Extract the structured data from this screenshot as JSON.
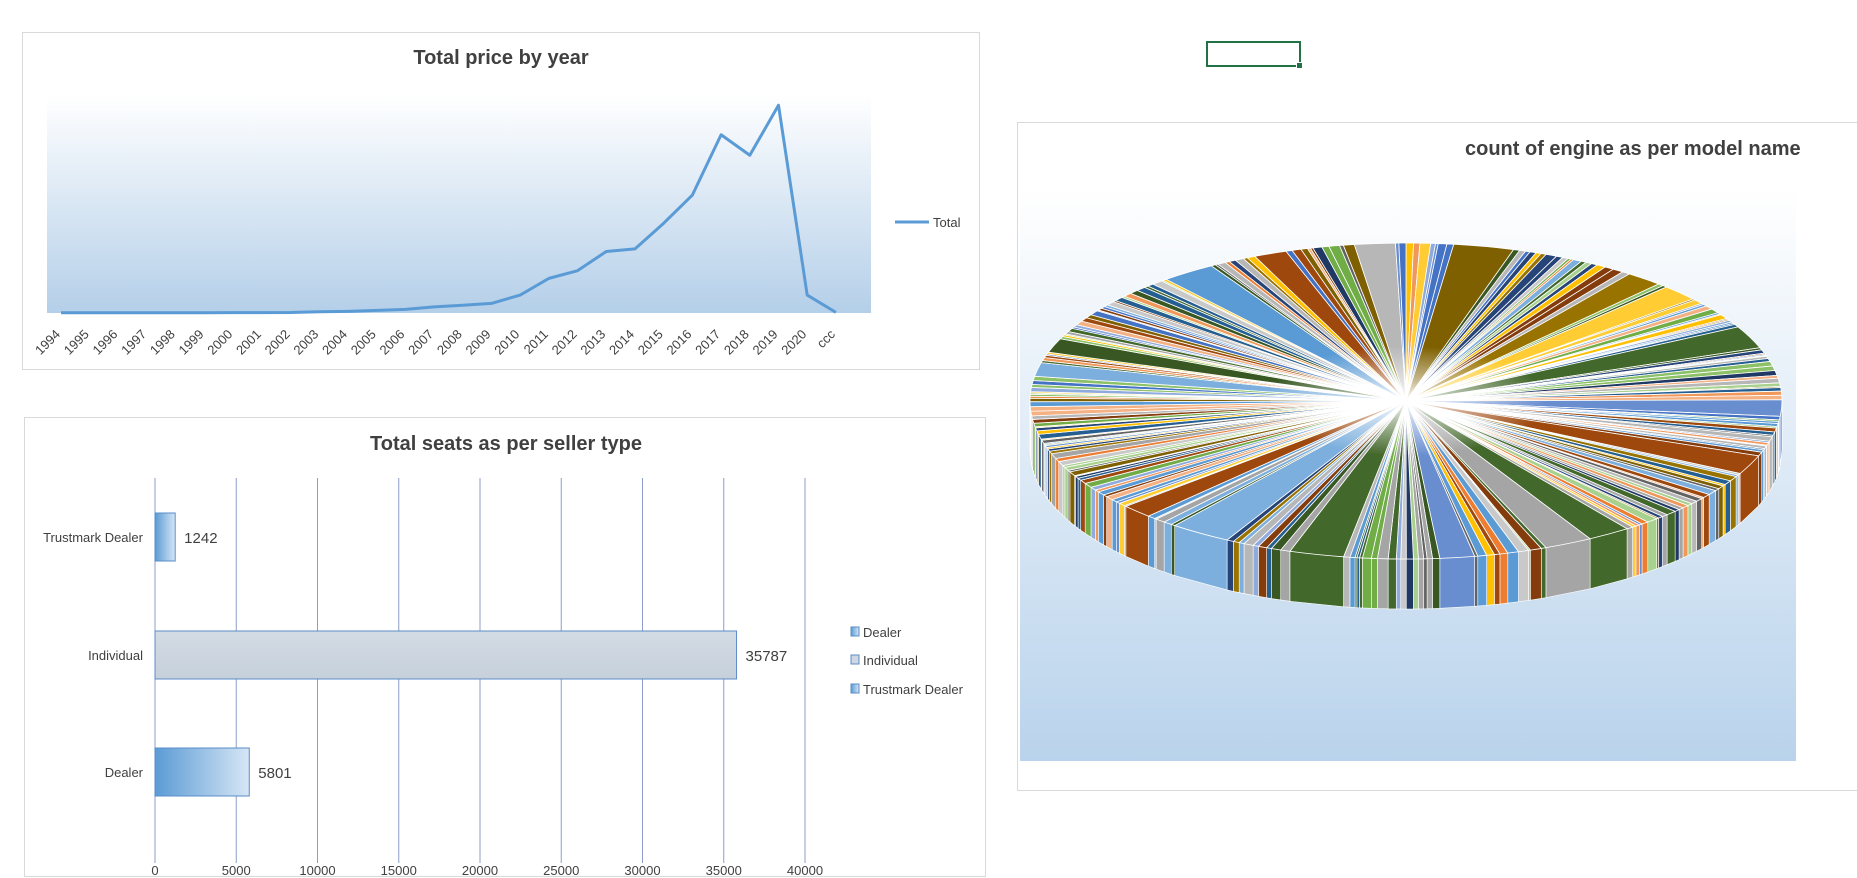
{
  "line_chart": {
    "title": "Total price by year",
    "legend": "Total",
    "color": "#5b9bd5"
  },
  "bar_chart": {
    "title": "Total seats as per seller type",
    "legend": [
      "Dealer",
      "Individual",
      "Trustmark Dealer"
    ],
    "bar_color": "#5b9bd5",
    "individual_color": "#cfd8e2"
  },
  "pie_chart": {
    "title": "count of engine as per model name"
  },
  "chart_data": [
    {
      "type": "line",
      "title": "Total price by year",
      "categories": [
        "1994",
        "1995",
        "1996",
        "1997",
        "1998",
        "1999",
        "2000",
        "2001",
        "2002",
        "2003",
        "2004",
        "2005",
        "2006",
        "2007",
        "2008",
        "2009",
        "2010",
        "2011",
        "2012",
        "2013",
        "2014",
        "2015",
        "2016",
        "2017",
        "2018",
        "2019",
        "2020",
        "ccc"
      ],
      "series": [
        {
          "name": "Total",
          "values": [
            0.2,
            0.2,
            0.2,
            0.2,
            0.2,
            0.2,
            0.3,
            0.3,
            0.4,
            1.0,
            1.3,
            2.0,
            2.8,
            4.8,
            6.0,
            7.5,
            14,
            27,
            33,
            48,
            50,
            70,
            92,
            139,
            123,
            162,
            14,
            0.5
          ]
        }
      ],
      "legend_position": "right",
      "grid": false
    },
    {
      "type": "bar",
      "orientation": "horizontal",
      "title": "Total seats as per seller type",
      "categories": [
        "Trustmark Dealer",
        "Individual",
        "Dealer"
      ],
      "values": [
        1242,
        35787,
        5801
      ],
      "xlim": [
        0,
        40000
      ],
      "xticks": [
        0,
        5000,
        10000,
        15000,
        20000,
        25000,
        30000,
        35000,
        40000
      ],
      "legend": [
        "Dealer",
        "Individual",
        "Trustmark Dealer"
      ],
      "legend_position": "right",
      "grid": true
    },
    {
      "type": "pie",
      "title": "count of engine as per model name",
      "style": "3d"
    }
  ]
}
